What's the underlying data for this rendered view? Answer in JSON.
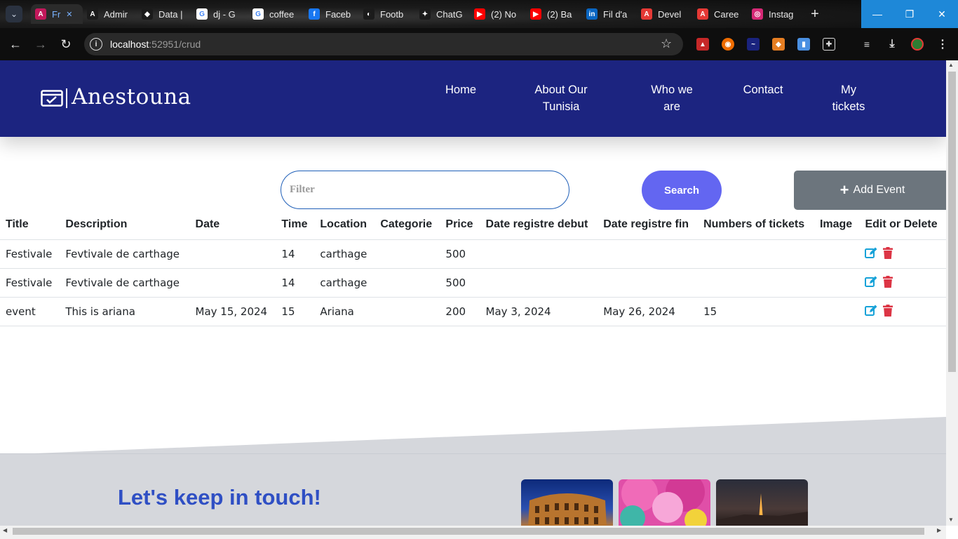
{
  "browser": {
    "tabs": [
      {
        "title": "Fr",
        "favicon_color": "#c2185b",
        "favicon_glyph": "A"
      },
      {
        "title": "Admir",
        "favicon_color": "#1b1b1b",
        "favicon_glyph": "A"
      },
      {
        "title": "Data |",
        "favicon_color": "#1b1b1b",
        "favicon_glyph": "◆"
      },
      {
        "title": "dj - G",
        "favicon_color": "#ffffff",
        "favicon_glyph": "G"
      },
      {
        "title": "coffee",
        "favicon_color": "#ffffff",
        "favicon_glyph": "G"
      },
      {
        "title": "Faceb",
        "favicon_color": "#1877f2",
        "favicon_glyph": "f"
      },
      {
        "title": "Footb",
        "favicon_color": "#1b1b1b",
        "favicon_glyph": "◐"
      },
      {
        "title": "ChatG",
        "favicon_color": "#1b1b1b",
        "favicon_glyph": "✦"
      },
      {
        "title": "(2) No",
        "favicon_color": "#ff0000",
        "favicon_glyph": "▶"
      },
      {
        "title": "(2) Ba",
        "favicon_color": "#ff0000",
        "favicon_glyph": "▶"
      },
      {
        "title": "Fil d'a",
        "favicon_color": "#0a66c2",
        "favicon_glyph": "in"
      },
      {
        "title": "Devel",
        "favicon_color": "#e53935",
        "favicon_glyph": "A"
      },
      {
        "title": "Caree",
        "favicon_color": "#e53935",
        "favicon_glyph": "A"
      },
      {
        "title": "Instag",
        "favicon_color": "#d62976",
        "favicon_glyph": "◎"
      }
    ],
    "new_tab_symbol": "+",
    "url_host": "localhost",
    "url_rest": ":52951/crud"
  },
  "site": {
    "brand": "Anestouna",
    "nav": [
      {
        "label_line1": "Home",
        "label_line2": ""
      },
      {
        "label_line1": "About Our",
        "label_line2": "Tunisia"
      },
      {
        "label_line1": "Who we",
        "label_line2": "are"
      },
      {
        "label_line1": "Contact",
        "label_line2": ""
      },
      {
        "label_line1": "My",
        "label_line2": "tickets"
      }
    ],
    "header_color": "#1c2480"
  },
  "controls": {
    "filter_placeholder": "Filter",
    "search_label": "Search",
    "add_label": "Add Event",
    "add_icon": "+"
  },
  "table": {
    "columns": [
      "Title",
      "Description",
      "Date",
      "Time",
      "Location",
      "Categorie",
      "Price",
      "Date registre debut",
      "Date registre fin",
      "Numbers of tickets",
      "Image",
      "Edit or Delete"
    ],
    "rows": [
      [
        "Festivale",
        "Fevtivale de carthage",
        "",
        "14",
        "carthage",
        "",
        "500",
        "",
        "",
        "",
        ""
      ],
      [
        "Festivale",
        "Fevtivale de carthage",
        "",
        "14",
        "carthage",
        "",
        "500",
        "",
        "",
        "",
        ""
      ],
      [
        "event",
        "This is ariana",
        "May 15, 2024",
        "15",
        "Ariana",
        "",
        "200",
        "May 3, 2024",
        "May 26, 2024",
        "15",
        ""
      ]
    ],
    "edit_icon_color": "#17a2d8",
    "delete_icon_color": "#dc3545"
  },
  "footer": {
    "title": "Let's keep in touch!"
  }
}
